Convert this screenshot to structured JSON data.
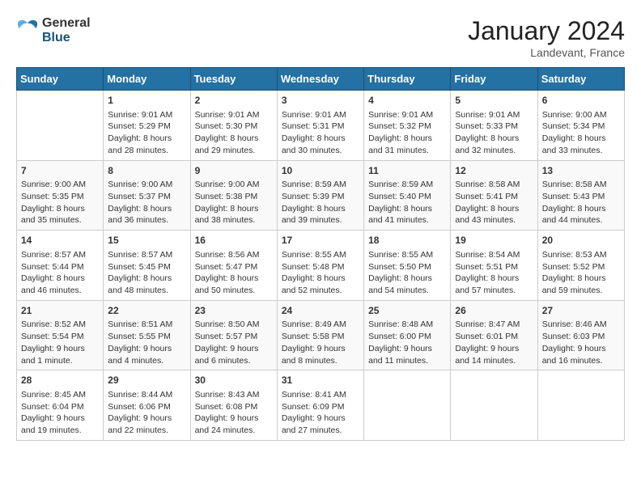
{
  "header": {
    "logo": {
      "general": "General",
      "blue": "Blue"
    },
    "title": "January 2024",
    "location": "Landevant, France"
  },
  "calendar": {
    "days_of_week": [
      "Sunday",
      "Monday",
      "Tuesday",
      "Wednesday",
      "Thursday",
      "Friday",
      "Saturday"
    ],
    "weeks": [
      [
        {
          "day": "",
          "sunrise": "",
          "sunset": "",
          "daylight": ""
        },
        {
          "day": "1",
          "sunrise": "Sunrise: 9:01 AM",
          "sunset": "Sunset: 5:29 PM",
          "daylight": "Daylight: 8 hours and 28 minutes."
        },
        {
          "day": "2",
          "sunrise": "Sunrise: 9:01 AM",
          "sunset": "Sunset: 5:30 PM",
          "daylight": "Daylight: 8 hours and 29 minutes."
        },
        {
          "day": "3",
          "sunrise": "Sunrise: 9:01 AM",
          "sunset": "Sunset: 5:31 PM",
          "daylight": "Daylight: 8 hours and 30 minutes."
        },
        {
          "day": "4",
          "sunrise": "Sunrise: 9:01 AM",
          "sunset": "Sunset: 5:32 PM",
          "daylight": "Daylight: 8 hours and 31 minutes."
        },
        {
          "day": "5",
          "sunrise": "Sunrise: 9:01 AM",
          "sunset": "Sunset: 5:33 PM",
          "daylight": "Daylight: 8 hours and 32 minutes."
        },
        {
          "day": "6",
          "sunrise": "Sunrise: 9:00 AM",
          "sunset": "Sunset: 5:34 PM",
          "daylight": "Daylight: 8 hours and 33 minutes."
        }
      ],
      [
        {
          "day": "7",
          "sunrise": "Sunrise: 9:00 AM",
          "sunset": "Sunset: 5:35 PM",
          "daylight": "Daylight: 8 hours and 35 minutes."
        },
        {
          "day": "8",
          "sunrise": "Sunrise: 9:00 AM",
          "sunset": "Sunset: 5:37 PM",
          "daylight": "Daylight: 8 hours and 36 minutes."
        },
        {
          "day": "9",
          "sunrise": "Sunrise: 9:00 AM",
          "sunset": "Sunset: 5:38 PM",
          "daylight": "Daylight: 8 hours and 38 minutes."
        },
        {
          "day": "10",
          "sunrise": "Sunrise: 8:59 AM",
          "sunset": "Sunset: 5:39 PM",
          "daylight": "Daylight: 8 hours and 39 minutes."
        },
        {
          "day": "11",
          "sunrise": "Sunrise: 8:59 AM",
          "sunset": "Sunset: 5:40 PM",
          "daylight": "Daylight: 8 hours and 41 minutes."
        },
        {
          "day": "12",
          "sunrise": "Sunrise: 8:58 AM",
          "sunset": "Sunset: 5:41 PM",
          "daylight": "Daylight: 8 hours and 43 minutes."
        },
        {
          "day": "13",
          "sunrise": "Sunrise: 8:58 AM",
          "sunset": "Sunset: 5:43 PM",
          "daylight": "Daylight: 8 hours and 44 minutes."
        }
      ],
      [
        {
          "day": "14",
          "sunrise": "Sunrise: 8:57 AM",
          "sunset": "Sunset: 5:44 PM",
          "daylight": "Daylight: 8 hours and 46 minutes."
        },
        {
          "day": "15",
          "sunrise": "Sunrise: 8:57 AM",
          "sunset": "Sunset: 5:45 PM",
          "daylight": "Daylight: 8 hours and 48 minutes."
        },
        {
          "day": "16",
          "sunrise": "Sunrise: 8:56 AM",
          "sunset": "Sunset: 5:47 PM",
          "daylight": "Daylight: 8 hours and 50 minutes."
        },
        {
          "day": "17",
          "sunrise": "Sunrise: 8:55 AM",
          "sunset": "Sunset: 5:48 PM",
          "daylight": "Daylight: 8 hours and 52 minutes."
        },
        {
          "day": "18",
          "sunrise": "Sunrise: 8:55 AM",
          "sunset": "Sunset: 5:50 PM",
          "daylight": "Daylight: 8 hours and 54 minutes."
        },
        {
          "day": "19",
          "sunrise": "Sunrise: 8:54 AM",
          "sunset": "Sunset: 5:51 PM",
          "daylight": "Daylight: 8 hours and 57 minutes."
        },
        {
          "day": "20",
          "sunrise": "Sunrise: 8:53 AM",
          "sunset": "Sunset: 5:52 PM",
          "daylight": "Daylight: 8 hours and 59 minutes."
        }
      ],
      [
        {
          "day": "21",
          "sunrise": "Sunrise: 8:52 AM",
          "sunset": "Sunset: 5:54 PM",
          "daylight": "Daylight: 9 hours and 1 minute."
        },
        {
          "day": "22",
          "sunrise": "Sunrise: 8:51 AM",
          "sunset": "Sunset: 5:55 PM",
          "daylight": "Daylight: 9 hours and 4 minutes."
        },
        {
          "day": "23",
          "sunrise": "Sunrise: 8:50 AM",
          "sunset": "Sunset: 5:57 PM",
          "daylight": "Daylight: 9 hours and 6 minutes."
        },
        {
          "day": "24",
          "sunrise": "Sunrise: 8:49 AM",
          "sunset": "Sunset: 5:58 PM",
          "daylight": "Daylight: 9 hours and 8 minutes."
        },
        {
          "day": "25",
          "sunrise": "Sunrise: 8:48 AM",
          "sunset": "Sunset: 6:00 PM",
          "daylight": "Daylight: 9 hours and 11 minutes."
        },
        {
          "day": "26",
          "sunrise": "Sunrise: 8:47 AM",
          "sunset": "Sunset: 6:01 PM",
          "daylight": "Daylight: 9 hours and 14 minutes."
        },
        {
          "day": "27",
          "sunrise": "Sunrise: 8:46 AM",
          "sunset": "Sunset: 6:03 PM",
          "daylight": "Daylight: 9 hours and 16 minutes."
        }
      ],
      [
        {
          "day": "28",
          "sunrise": "Sunrise: 8:45 AM",
          "sunset": "Sunset: 6:04 PM",
          "daylight": "Daylight: 9 hours and 19 minutes."
        },
        {
          "day": "29",
          "sunrise": "Sunrise: 8:44 AM",
          "sunset": "Sunset: 6:06 PM",
          "daylight": "Daylight: 9 hours and 22 minutes."
        },
        {
          "day": "30",
          "sunrise": "Sunrise: 8:43 AM",
          "sunset": "Sunset: 6:08 PM",
          "daylight": "Daylight: 9 hours and 24 minutes."
        },
        {
          "day": "31",
          "sunrise": "Sunrise: 8:41 AM",
          "sunset": "Sunset: 6:09 PM",
          "daylight": "Daylight: 9 hours and 27 minutes."
        },
        {
          "day": "",
          "sunrise": "",
          "sunset": "",
          "daylight": ""
        },
        {
          "day": "",
          "sunrise": "",
          "sunset": "",
          "daylight": ""
        },
        {
          "day": "",
          "sunrise": "",
          "sunset": "",
          "daylight": ""
        }
      ]
    ]
  }
}
